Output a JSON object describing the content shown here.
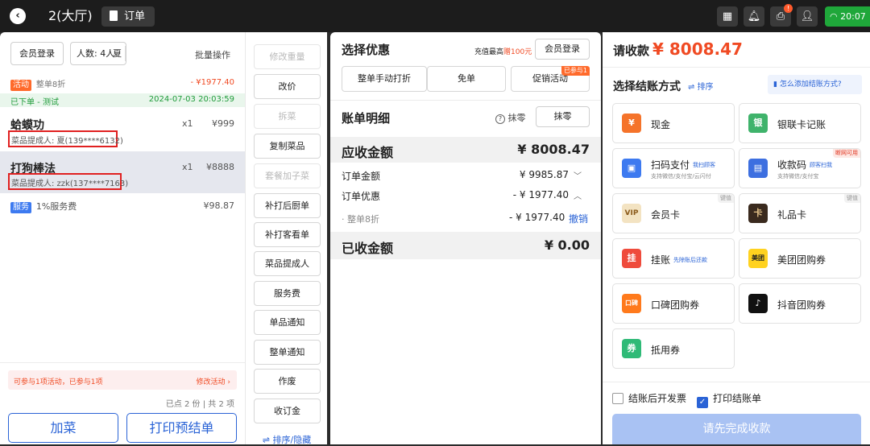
{
  "topbar": {
    "table_name": "2(大厅)",
    "order_label": "订单",
    "alert_badge": "!",
    "time": "20:07"
  },
  "left": {
    "member_login": "会员登录",
    "guests": "人数: 4人",
    "guest_extra": "夏",
    "batch_ops": "批量操作",
    "activity_tag": "活动",
    "activity_text": "整单8折",
    "activity_amount": "- ¥1977.40",
    "placed_text": "已下单 - 测试",
    "placed_time": "2024-07-03 20:03:59",
    "items": [
      {
        "name": "蛤蟆功",
        "qty": "x1",
        "price": "¥999",
        "proposer": "菜品提成人: 夏(139****6132)"
      },
      {
        "name": "打狗棒法",
        "qty": "x1",
        "price": "¥8888",
        "proposer": "菜品提成人: zzk(137****7163)"
      }
    ],
    "service_tag": "服务",
    "service_text": "1%服务费",
    "service_amount": "¥98.87",
    "promo_notice": "可参与1项活动，已参与1项",
    "promo_edit": "修改活动 ›",
    "count_summary": "已点 2 份 | 共 2 项",
    "add_dish": "加菜",
    "print_pre": "打印预结单"
  },
  "actions": {
    "items": [
      {
        "label": "修改重量",
        "disabled": true
      },
      {
        "label": "改价",
        "disabled": false
      },
      {
        "label": "拆菜",
        "disabled": true
      },
      {
        "label": "复制菜品",
        "disabled": false
      },
      {
        "label": "套餐加子菜",
        "disabled": true
      },
      {
        "label": "补打后厨单",
        "disabled": false
      },
      {
        "label": "补打客看单",
        "disabled": false
      },
      {
        "label": "菜品提成人",
        "disabled": false
      },
      {
        "label": "服务费",
        "disabled": false
      },
      {
        "label": "单品通知",
        "disabled": false
      },
      {
        "label": "整单通知",
        "disabled": false
      },
      {
        "label": "作废",
        "disabled": false
      },
      {
        "label": "收订金",
        "disabled": false
      }
    ],
    "sort_hide": "⇌ 排序/隐藏"
  },
  "discount": {
    "title": "选择优惠",
    "recharge_prefix": "充值最高",
    "recharge_highlight": "赠100元",
    "member_login": "会员登录",
    "buttons": [
      "整单手动打折",
      "免单",
      "促销活动"
    ],
    "joined_badge": "已参与1"
  },
  "bill": {
    "title": "账单明细",
    "rounding_label": "抹零",
    "rounding_button": "抹零",
    "receivable_label": "应收金额",
    "receivable_value": "¥ 8008.47",
    "order_amount_label": "订单金额",
    "order_amount_value": "¥ 9985.87",
    "order_discount_label": "订单优惠",
    "order_discount_value": "- ¥ 1977.40",
    "sub_label": "· 整单8折",
    "sub_value": "- ¥ 1977.40",
    "revoke": "撤销",
    "received_label": "已收金额",
    "received_value": "¥ 0.00"
  },
  "payment": {
    "due_label": "请收款",
    "due_value": "¥ 8008.47",
    "method_title": "选择结账方式",
    "sort": "⇌ 排序",
    "how_to_add": "怎么添加结账方式?",
    "methods": [
      {
        "label": "现金",
        "icon": "¥",
        "color": "#f5732a"
      },
      {
        "label": "银联卡记账",
        "icon": "银",
        "color": "#3fb36b"
      },
      {
        "label": "扫码支付",
        "note": "我扫顾客",
        "sub": "支持微信/支付宝/云闪付",
        "icon": "▣",
        "color": "#3d7af0"
      },
      {
        "label": "收款码",
        "note": "顾客扫我",
        "sub": "支持微信/支付宝",
        "icon": "▤",
        "color": "#3d6fe0",
        "corner": "断网可用"
      },
      {
        "label": "会员卡",
        "icon": "VIP",
        "color": "#f3e3c2",
        "corner": "键值"
      },
      {
        "label": "礼品卡",
        "icon": "卡",
        "color": "#3a2a1e",
        "corner": "键值"
      },
      {
        "label": "挂账",
        "note": "先除账后还款",
        "icon": "挂",
        "color": "#ef4b3c"
      },
      {
        "label": "美团团购券",
        "icon": "美团",
        "color": "#ffd21f"
      },
      {
        "label": "口碑团购券",
        "icon": "口碑",
        "color": "#ff7a1c"
      },
      {
        "label": "抖音团购券",
        "icon": "♪",
        "color": "#111111"
      },
      {
        "label": "抵用券",
        "icon": "券",
        "color": "#2fba77"
      }
    ],
    "invoice_after": "结账后开发票",
    "print_receipt": "打印结账单",
    "complete": "请先完成收款"
  },
  "colors": {
    "accent": "#2a63d6",
    "price_red": "#f04a23",
    "placed_green": "#1f9b3a"
  }
}
